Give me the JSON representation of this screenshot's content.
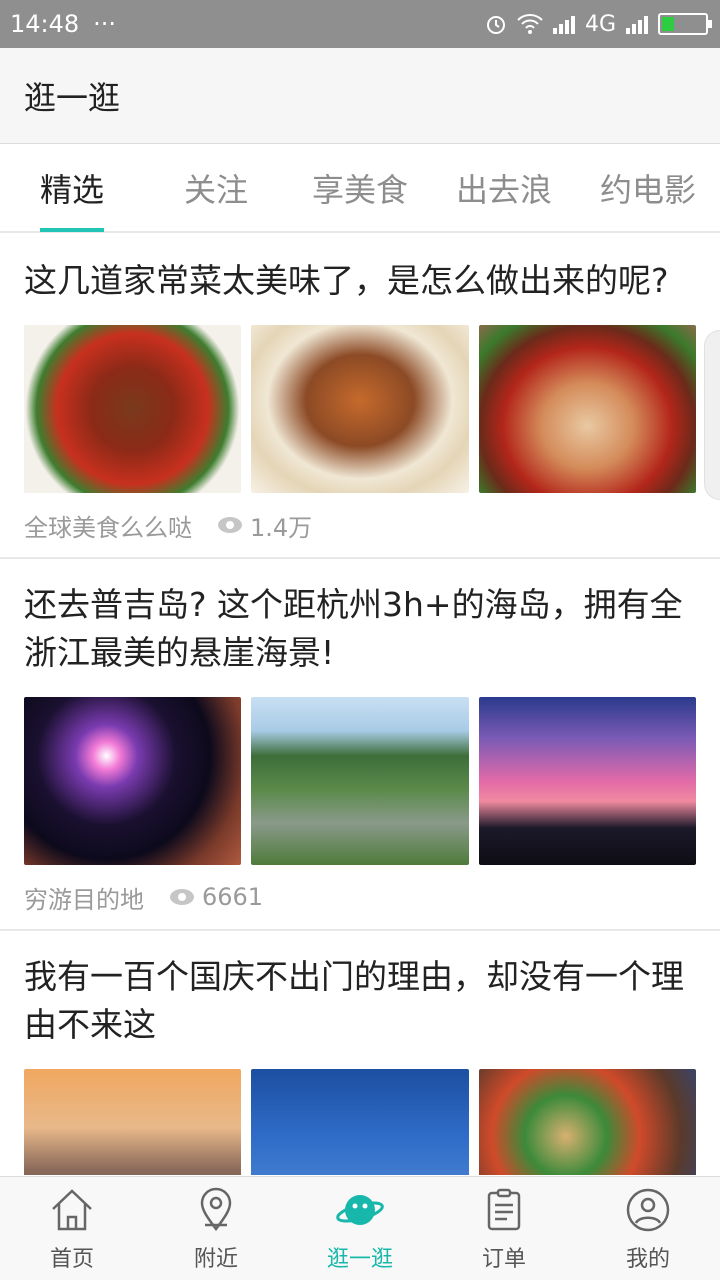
{
  "status_bar": {
    "time": "14:48",
    "dots": "···",
    "network": "4G"
  },
  "header": {
    "title": "逛一逛"
  },
  "tabs": [
    "精选",
    "关注",
    "享美食",
    "出去浪",
    "约电影"
  ],
  "active_tab": 0,
  "cards": [
    {
      "title": "这几道家常菜太美味了，是怎么做出来的呢?",
      "author": "全球美食么么哒",
      "views": "1.4万"
    },
    {
      "title": "还去普吉岛? 这个距杭州3h+的海岛，拥有全浙江最美的悬崖海景!",
      "author": "穷游目的地",
      "views": "6661"
    },
    {
      "title": "我有一百个国庆不出门的理由，却没有一个理由不来这",
      "author": "",
      "views": ""
    }
  ],
  "bottom_nav": [
    {
      "label": "首页",
      "icon": "home-icon"
    },
    {
      "label": "附近",
      "icon": "location-pin-icon"
    },
    {
      "label": "逛一逛",
      "icon": "planet-icon"
    },
    {
      "label": "订单",
      "icon": "clipboard-icon"
    },
    {
      "label": "我的",
      "icon": "user-icon"
    }
  ],
  "active_nav": 2,
  "colors": {
    "accent": "#17b8ab",
    "status_bar": "#8f8f8f",
    "battery": "#2ecc40"
  }
}
